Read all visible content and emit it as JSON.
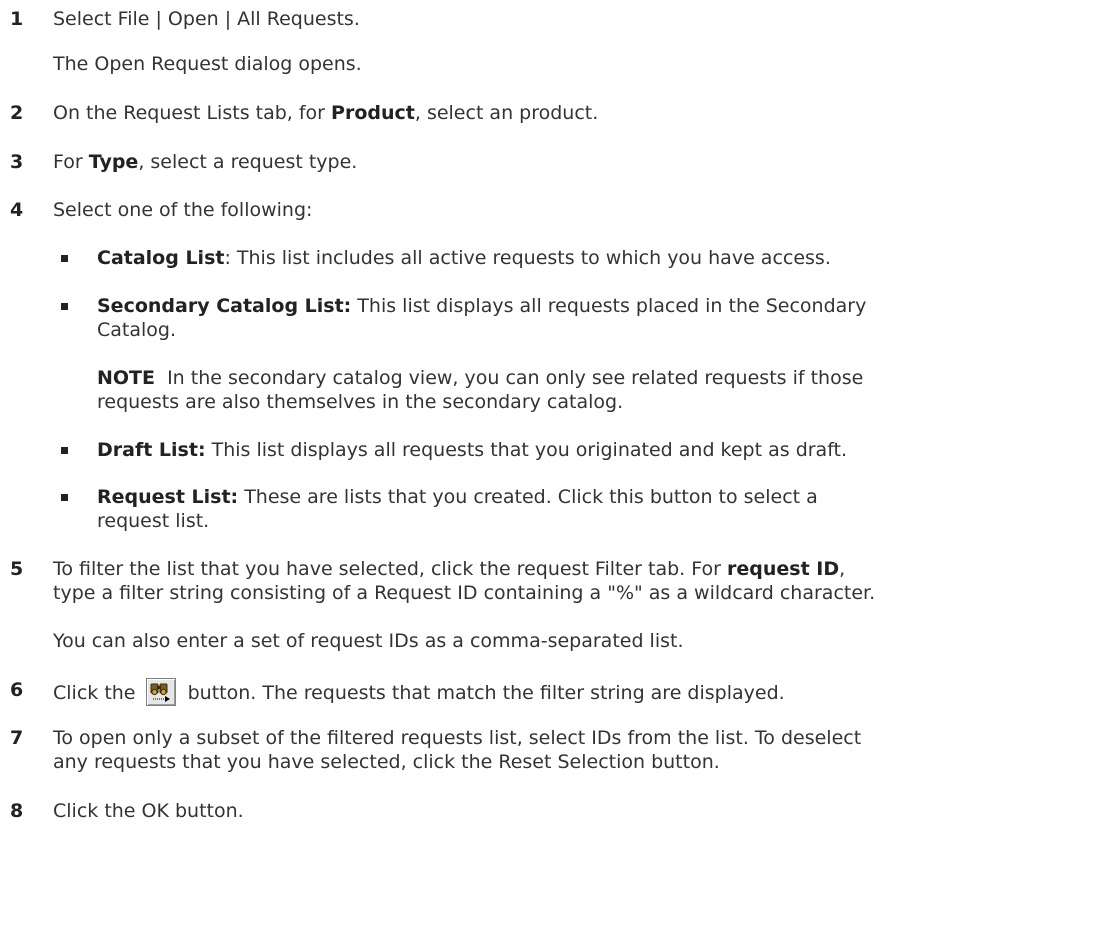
{
  "steps": {
    "s1": {
      "num": "1",
      "text": "Select File | Open | All Requests.",
      "note": "The Open Request dialog opens."
    },
    "s2": {
      "num": "2",
      "a": "On the Request Lists tab, for ",
      "b": "Product",
      "c": ", select an product."
    },
    "s3": {
      "num": "3",
      "a": "For ",
      "b": "Type",
      "c": ", select a request type."
    },
    "s4": {
      "num": "4",
      "text": "Select one of the following:"
    },
    "s5": {
      "num": "5",
      "a": "To filter the list that you have selected, click the request Filter tab. For ",
      "b": "request ID",
      "c": ",",
      "line2": "type a filter string consisting of a Request ID containing a \"%\" as a wildcard character.",
      "note": "You can also enter a set of request IDs as a comma-separated list."
    },
    "s6": {
      "num": "6",
      "a": "Click the ",
      "c": " button. The requests that match the filter string are displayed."
    },
    "s7": {
      "num": "7",
      "line1": "To open only a subset of the filtered requests list, select IDs from the list. To deselect",
      "line2": "any requests that you have selected, click the Reset Selection button."
    },
    "s8": {
      "num": "8",
      "text": "Click the OK button."
    }
  },
  "bullets": [
    {
      "label": "Catalog List",
      "rest": ": This list includes all active requests to which you have access."
    },
    {
      "label": "Secondary Catalog List:",
      "rest": " This list displays all requests placed in the Secondary",
      "cont": "Catalog."
    },
    {
      "label": "Draft List:",
      "rest": " This list displays all requests that you originated and kept as draft."
    },
    {
      "label": "Request List:",
      "rest": " These are lists that you created. Click this button to select a",
      "cont": "request list."
    }
  ],
  "note": {
    "label": "NOTE",
    "line1": "  In the secondary catalog view, you can only see related requests if those",
    "line2": "requests are also themselves in the secondary catalog."
  },
  "icons": {
    "filter_button": "binoculars-filter-icon"
  }
}
